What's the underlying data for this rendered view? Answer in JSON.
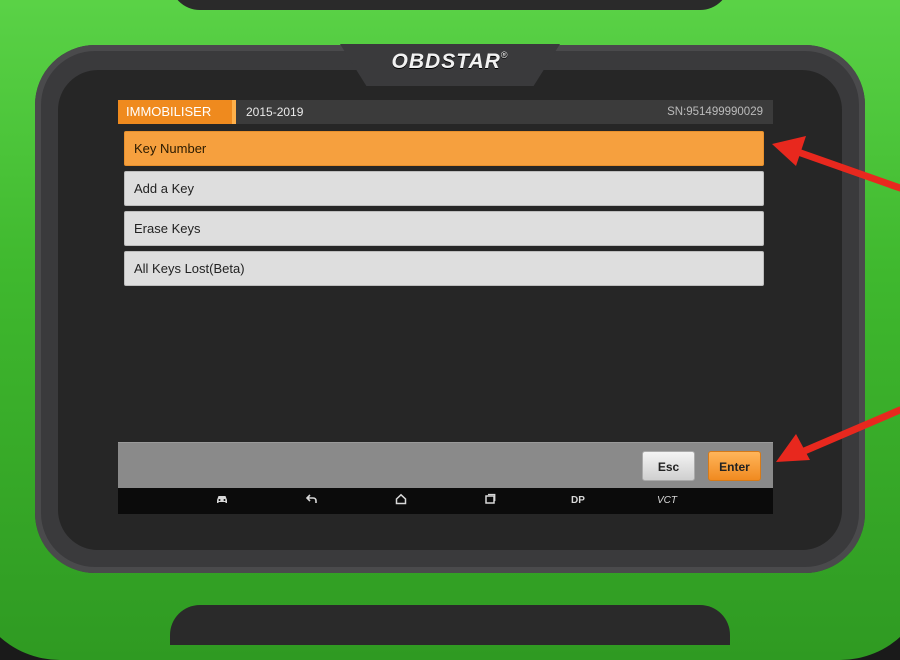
{
  "device": {
    "brand": "OBDSTAR",
    "trademark": "®"
  },
  "title_bar": {
    "module": "IMMOBILISER",
    "year_range": "2015-2019",
    "serial": "SN:951499990029"
  },
  "menu": {
    "items": [
      {
        "label": "Key Number",
        "selected": true
      },
      {
        "label": "Add a Key",
        "selected": false
      },
      {
        "label": "Erase Keys",
        "selected": false
      },
      {
        "label": "All Keys Lost(Beta)",
        "selected": false
      }
    ]
  },
  "actions": {
    "esc_label": "Esc",
    "enter_label": "Enter"
  },
  "nav": {
    "icons": [
      "car-icon",
      "back-icon",
      "home-icon",
      "recent-apps-icon"
    ],
    "dp_label": "DP",
    "vct_label": "VCT"
  },
  "colors": {
    "accent": "#f6a03e",
    "housing": "#44c032",
    "arrow": "#e8281e"
  }
}
